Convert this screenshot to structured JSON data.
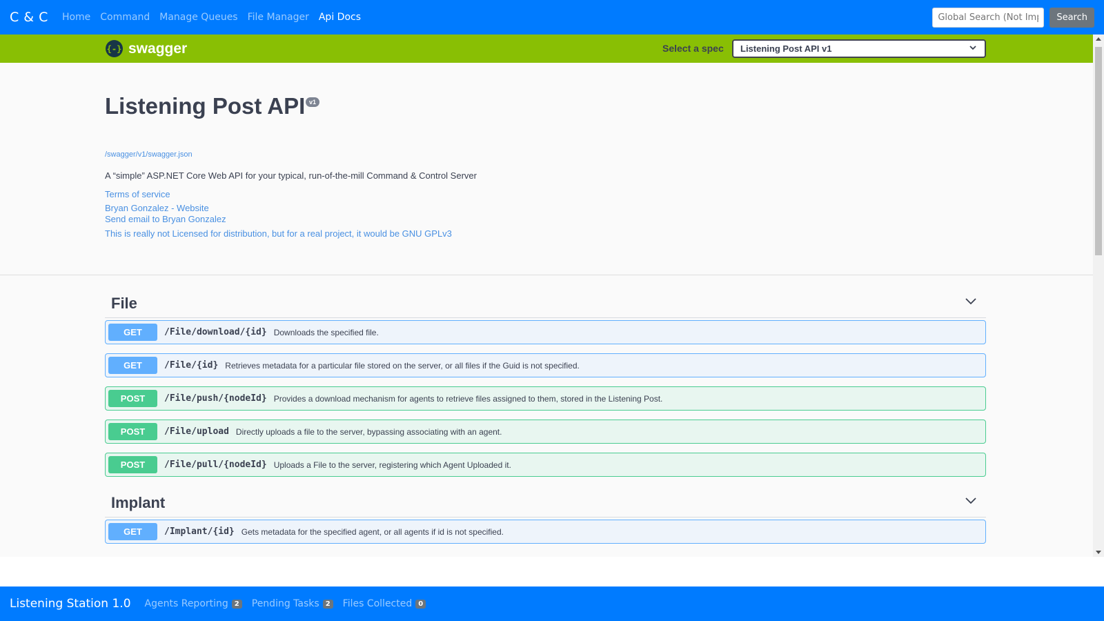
{
  "navbar": {
    "brand": "C & C",
    "links": [
      "Home",
      "Command",
      "Manage Queues",
      "File Manager",
      "Api Docs"
    ],
    "search_placeholder": "Global Search (Not Implemented)",
    "search_label": "Search"
  },
  "swagger": {
    "logo_text": "swagger",
    "logo_glyph": "{-}",
    "spec_label": "Select a spec",
    "spec_selected": "Listening Post API v1"
  },
  "info": {
    "title": "Listening Post API",
    "version": "v1",
    "url": "/swagger/v1/swagger.json",
    "description": "A “simple” ASP.NET Core Web API for your typical, run-of-the-mill Command & Control Server",
    "terms": "Terms of service",
    "contact_website": "Bryan Gonzalez - Website",
    "contact_email": "Send email to Bryan Gonzalez",
    "license": "This is really not Licensed for distribution, but for a real project, it would be GNU GPLv3"
  },
  "tags": [
    {
      "name": "File",
      "operations": [
        {
          "method": "GET",
          "path": "/File/download/{id}",
          "summary": "Downloads the specified file."
        },
        {
          "method": "GET",
          "path": "/File/{id}",
          "summary": "Retrieves metadata for a particular file stored on the server, or all files if the Guid is not specified."
        },
        {
          "method": "POST",
          "path": "/File/push/{nodeId}",
          "summary": "Provides a download mechanism for agents to retrieve files assigned to them, stored in the Listening Post."
        },
        {
          "method": "POST",
          "path": "/File/upload",
          "summary": "Directly uploads a file to the server, bypassing associating with an agent."
        },
        {
          "method": "POST",
          "path": "/File/pull/{nodeId}",
          "summary": "Uploads a File to the server, registering which Agent Uploaded it."
        }
      ]
    },
    {
      "name": "Implant",
      "operations": [
        {
          "method": "GET",
          "path": "/Implant/{id}",
          "summary": "Gets metadata for the specified agent, or all agents if id is not specified."
        }
      ]
    }
  ],
  "footer": {
    "brand": "Listening Station 1.0",
    "items": [
      {
        "label": "Agents Reporting",
        "count": "2"
      },
      {
        "label": "Pending Tasks",
        "count": "2"
      },
      {
        "label": "Files Collected",
        "count": "0"
      }
    ]
  }
}
